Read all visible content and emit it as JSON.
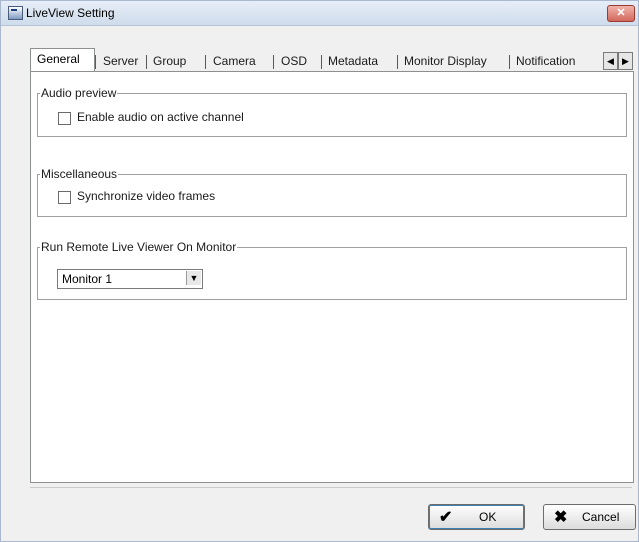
{
  "window": {
    "title": "LiveView Setting",
    "close_glyph": "✕"
  },
  "tabs": [
    "General",
    "Server",
    "Group",
    "Camera",
    "OSD",
    "Metadata",
    "Monitor Display",
    "Notification"
  ],
  "active_tab": "General",
  "tab_scroll": {
    "left": "◀",
    "right": "▶"
  },
  "groups": {
    "audio": {
      "legend": "Audio preview",
      "checkbox_label": "Enable audio on active channel",
      "checked": false
    },
    "misc": {
      "legend": "Miscellaneous",
      "checkbox_label": "Synchronize video frames",
      "checked": false
    },
    "monitor": {
      "legend": "Run Remote Live Viewer On Monitor",
      "selected": "Monitor 1"
    }
  },
  "buttons": {
    "ok": "OK",
    "cancel": "Cancel",
    "ok_icon": "✔",
    "cancel_icon": "✖"
  }
}
